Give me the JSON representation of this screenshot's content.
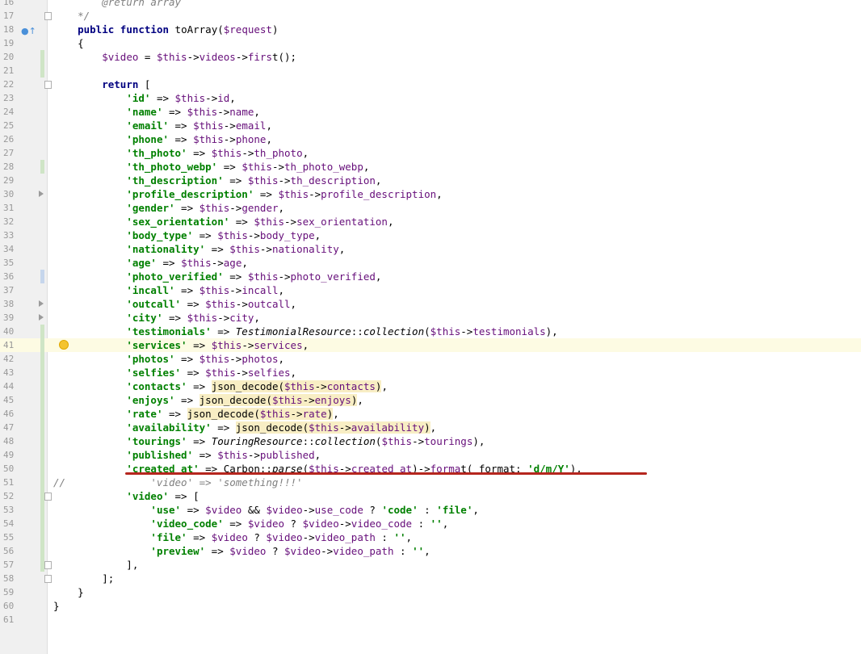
{
  "editor": {
    "lines": [
      {
        "n": "16",
        "t": "        @return array",
        "top": 0
      },
      {
        "n": "17",
        "t": "    */"
      },
      {
        "n": "18",
        "t": "    public function toArray($request)"
      },
      {
        "n": "19",
        "t": "    {"
      },
      {
        "n": "20",
        "t": "        $video = $this->videos->first();"
      },
      {
        "n": "21",
        "t": ""
      },
      {
        "n": "22",
        "t": "        return ["
      },
      {
        "n": "23",
        "t": "            'id' => $this->id,"
      },
      {
        "n": "24",
        "t": "            'name' => $this->name,"
      },
      {
        "n": "25",
        "t": "            'email' => $this->email,"
      },
      {
        "n": "26",
        "t": "            'phone' => $this->phone,"
      },
      {
        "n": "27",
        "t": "            'th_photo' => $this->th_photo,"
      },
      {
        "n": "28",
        "t": "            'th_photo_webp' => $this->th_photo_webp,"
      },
      {
        "n": "29",
        "t": "            'th_description' => $this->th_description,"
      },
      {
        "n": "30",
        "t": "            'profile_description' => $this->profile_description,"
      },
      {
        "n": "31",
        "t": "            'gender' => $this->gender,"
      },
      {
        "n": "32",
        "t": "            'sex_orientation' => $this->sex_orientation,"
      },
      {
        "n": "33",
        "t": "            'body_type' => $this->body_type,"
      },
      {
        "n": "34",
        "t": "            'nationality' => $this->nationality,"
      },
      {
        "n": "35",
        "t": "            'age' => $this->age,"
      },
      {
        "n": "36",
        "t": "            'photo_verified' => $this->photo_verified,"
      },
      {
        "n": "37",
        "t": "            'incall' => $this->incall,"
      },
      {
        "n": "38",
        "t": "            'outcall' => $this->outcall,"
      },
      {
        "n": "39",
        "t": "            'city' => $this->city,"
      },
      {
        "n": "40",
        "t": "            'testimonials' => TestimonialResource::collection($this->testimonials),"
      },
      {
        "n": "41",
        "t": "            'services' => $this->services,"
      },
      {
        "n": "42",
        "t": "            'photos' => $this->photos,"
      },
      {
        "n": "43",
        "t": "            'selfies' => $this->selfies,"
      },
      {
        "n": "44",
        "t": "            'contacts' => json_decode($this->contacts),"
      },
      {
        "n": "45",
        "t": "            'enjoys' => json_decode($this->enjoys),"
      },
      {
        "n": "46",
        "t": "            'rate' => json_decode($this->rate),"
      },
      {
        "n": "47",
        "t": "            'availability' => json_decode($this->availability),"
      },
      {
        "n": "48",
        "t": "            'tourings' => TouringResource::collection($this->tourings),"
      },
      {
        "n": "49",
        "t": "            'published' => $this->published,"
      },
      {
        "n": "50",
        "t": "            'created_at' => Carbon::parse($this->created_at)->format( format: 'd/m/Y'),"
      },
      {
        "n": "51",
        "t": "//              'video' => 'something!!!'"
      },
      {
        "n": "52",
        "t": "            'video' => ["
      },
      {
        "n": "53",
        "t": "                'use' => $video && $video->use_code ? 'code' : 'file',"
      },
      {
        "n": "54",
        "t": "                'video_code' => $video ? $video->video_code : '',"
      },
      {
        "n": "55",
        "t": "                'file' => $video ? $video->video_path : '',"
      },
      {
        "n": "56",
        "t": "                'preview' => $video ? $video->video_path : '',"
      },
      {
        "n": "57",
        "t": "            ],"
      },
      {
        "n": "58",
        "t": "        ];"
      },
      {
        "n": "59",
        "t": "    }"
      },
      {
        "n": "60",
        "t": "}"
      },
      {
        "n": "61",
        "t": ""
      }
    ]
  },
  "hint_label": "format:",
  "colors": {
    "keyword": "#000080",
    "string": "#008000",
    "variable": "#660e7a",
    "comment": "#808080",
    "underline": "#b5261e"
  }
}
